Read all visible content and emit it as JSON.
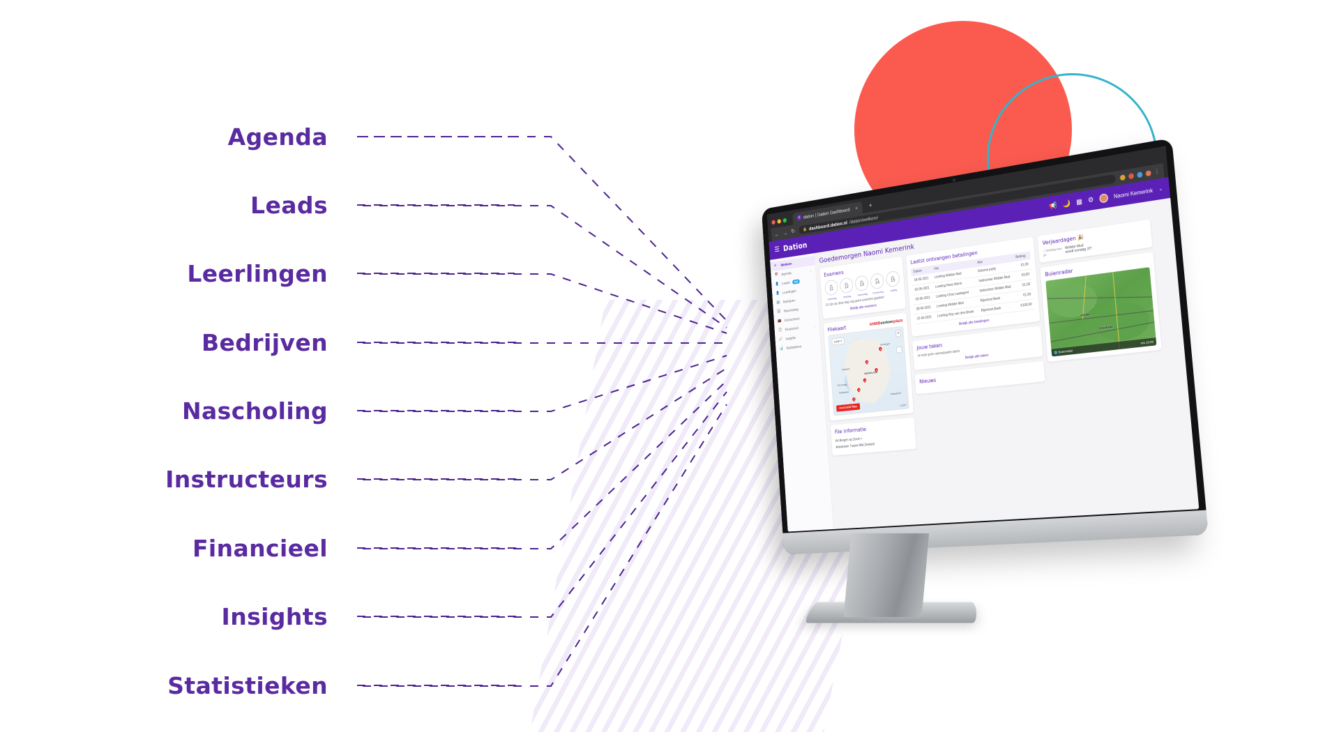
{
  "theme": {
    "purple": "#5b21b6",
    "label_purple": "#5a2ba0",
    "dash_purple": "#4b2191",
    "red_circle": "#fb5a4f",
    "teal_ring": "#36b3c9",
    "badge_blue": "#2aa5e0"
  },
  "callouts": [
    {
      "label": "Agenda"
    },
    {
      "label": "Leads"
    },
    {
      "label": "Leerlingen"
    },
    {
      "label": "Bedrijven"
    },
    {
      "label": "Nascholing"
    },
    {
      "label": "Instructeurs"
    },
    {
      "label": "Financieel"
    },
    {
      "label": "Insights"
    },
    {
      "label": "Statistieken"
    }
  ],
  "browser": {
    "tab_title": "dation | Dation Dashboard",
    "tab_favicon": "dation-favicon-icon",
    "tab_close": "×",
    "new_tab": "+",
    "back": "←",
    "forward": "→",
    "reload": "↻",
    "lock": "🔒",
    "url_bold": "dashboard.dation.nl",
    "url_rest": "/dation/welkom/"
  },
  "appbar": {
    "menu_icon": "hamburger-icon",
    "brand": "Dation",
    "icons": [
      "megaphone-icon",
      "moon-icon",
      "grid-icon",
      "gear-icon"
    ],
    "user_name": "Naomi Kemerink",
    "chevron": "⌄"
  },
  "sidebar": {
    "items": [
      {
        "label": "Welkom",
        "icon": "home-icon",
        "active": true,
        "badge": "",
        "chevron": ""
      },
      {
        "label": "Agenda",
        "icon": "calendar-icon",
        "active": false,
        "badge": "",
        "chevron": "⌄"
      },
      {
        "label": "Leads",
        "icon": "lead-user-icon",
        "active": false,
        "badge": "309",
        "chevron": ""
      },
      {
        "label": "Leerlingen",
        "icon": "user-icon",
        "active": false,
        "badge": "",
        "chevron": ""
      },
      {
        "label": "Bedrijven",
        "icon": "building-icon",
        "active": false,
        "badge": "",
        "chevron": ""
      },
      {
        "label": "Nascholing",
        "icon": "presentation-icon",
        "active": false,
        "badge": "",
        "chevron": ""
      },
      {
        "label": "Instructeurs",
        "icon": "instructor-icon",
        "active": false,
        "badge": "",
        "chevron": ""
      },
      {
        "label": "Financieel",
        "icon": "invoice-icon",
        "active": false,
        "badge": "",
        "chevron": "⌄"
      },
      {
        "label": "Insights",
        "icon": "chart-line-icon",
        "active": false,
        "badge": "",
        "chevron": ""
      },
      {
        "label": "Statistieken",
        "icon": "bar-chart-icon",
        "active": false,
        "badge": "",
        "chevron": ""
      }
    ]
  },
  "main": {
    "greeting": "Goedemorgen Naomi Kemerink",
    "examens": {
      "title": "Examens",
      "days": [
        {
          "month": "okt.",
          "day": "11",
          "weekday": "maandag"
        },
        {
          "month": "okt.",
          "day": "12",
          "weekday": "dinsdag"
        },
        {
          "month": "okt.",
          "day": "13",
          "weekday": "woensdag"
        },
        {
          "month": "okt.",
          "day": "14",
          "weekday": "donderdag"
        },
        {
          "month": "okt.",
          "day": "15",
          "weekday": "vrijdag"
        }
      ],
      "note": "Er zijn op deze dag nog geen examens gepland",
      "link": "Bekijk alle examens"
    },
    "filekaart": {
      "title": "Filekaart",
      "logo_pre": "ANWB",
      "logo_main": "verkeer",
      "logo_accent": "plaza",
      "zoom_chip": "1028 ⇕",
      "zoom_in": "+",
      "layers_icon": "map-layers-icon",
      "button": "Overzicht files",
      "attribution": "Leaflet",
      "pins": [
        "6",
        "6",
        "5",
        "4",
        "3",
        "2",
        "1"
      ],
      "cities": [
        "Groningen",
        "Haarlem",
        "Den Haag",
        "Rotterdam",
        "NEDERLAND",
        "Düsseldorf"
      ]
    },
    "file_info": {
      "title": "File informatie",
      "lines": [
        "A4 Bergen op Zoom >",
        "Antwerpen Tussen Mid Zeeland"
      ]
    },
    "betalingen": {
      "title": "Laatst ontvangen betalingen",
      "columns": [
        "Datum",
        "Van",
        "Aan",
        "Bedrag"
      ],
      "rows": [
        {
          "datum": "18-06-2021",
          "van": "Leerling Wobbe Mud",
          "aan": "Externe partij",
          "bedrag": "€1,00"
        },
        {
          "datum": "03-05-2021",
          "van": "Leerling Hans Worst",
          "aan": "Instructeur Wobbe Mud",
          "bedrag": "€3,00"
        },
        {
          "datum": "03-05-2021",
          "van": "Leerling Chris Landegent",
          "aan": "Instructeur Wobbe Mud",
          "bedrag": "€1,00"
        },
        {
          "datum": "28-04-2021",
          "van": "Leerling Wobbe Mud",
          "aan": "Rijschool Bank",
          "bedrag": "€1,50"
        },
        {
          "datum": "22-04-2021",
          "van": "Leerling Roy van den Broek",
          "aan": "Rijschool Bank",
          "bedrag": "€100,00"
        }
      ],
      "link": "Bekijk alle betalingen"
    },
    "taken": {
      "title": "Jouw taken",
      "empty": "Je hebt geen openstaande taken.",
      "link": "Bekijk alle taken"
    },
    "nieuws": {
      "title": "Nieuws"
    },
    "verjaardagen": {
      "title": "Verjaardagen",
      "emoji": "🎉",
      "broken_image_alt": "birthday-image",
      "person": "Wobbe Mud",
      "detail": "wordt zondag 37!"
    },
    "buienradar": {
      "title": "Buienradar",
      "footer_label": "Buienradar",
      "time": "ma 13:00",
      "cities": [
        "Almelo",
        "Enschede"
      ]
    }
  }
}
